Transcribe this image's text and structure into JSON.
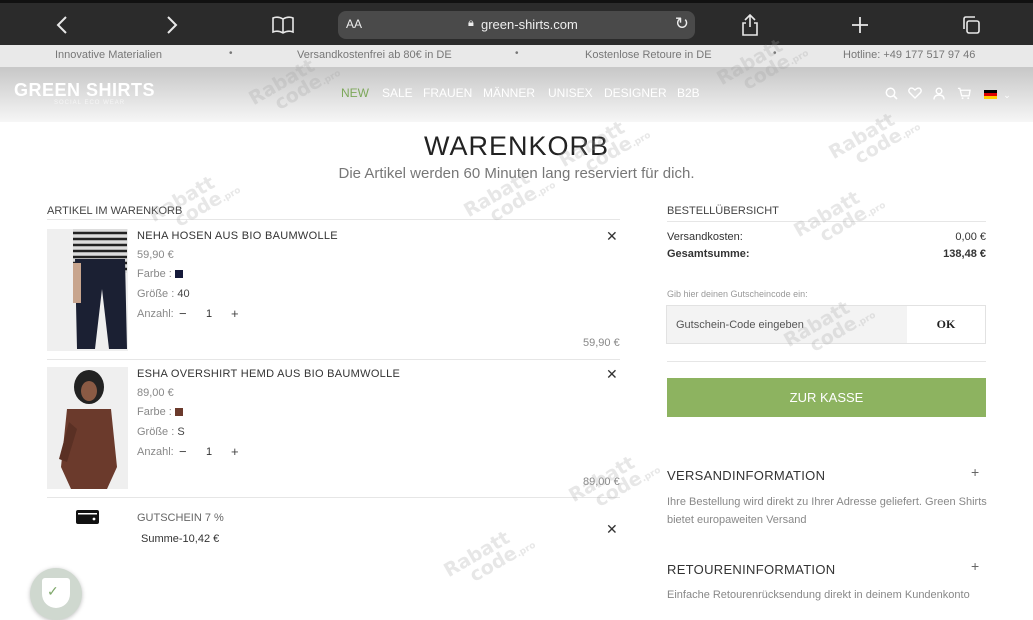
{
  "browser": {
    "aa_label": "AA",
    "url": "green-shirts.com"
  },
  "infobar": {
    "items": [
      "Innovative Materialien",
      "Versandkostenfrei ab 80€ in DE",
      "Kostenlose Retoure in DE",
      "Hotline: +49 177 517 97 46"
    ],
    "separator": "•"
  },
  "header": {
    "logo": "GREEN SHIRTS",
    "logo_tagline": "SOCIAL ECO WEAR",
    "nav": [
      "NEW",
      "SALE",
      "FRAUEN",
      "MÄNNER",
      "UNISEX",
      "DESIGNER",
      "B2B"
    ],
    "active_nav": "NEW",
    "active_color": "#7da85a"
  },
  "page": {
    "title": "WARENKORB",
    "subtitle": "Die Artikel werden 60 Minuten lang reserviert für dich."
  },
  "cart": {
    "heading": "ARTIKEL IM WARENKORB",
    "items": [
      {
        "name": "NEHA HOSEN AUS BIO BAUMWOLLE",
        "unit_price": "59,90 €",
        "color_label": "Farbe :",
        "color": "#151a3a",
        "size_label": "Größe :",
        "size": "40",
        "qty_label": "Anzahl:",
        "qty": "1",
        "total": "59,90 €"
      },
      {
        "name": "ESHA OVERSHIRT HEMD AUS BIO BAUMWOLLE",
        "unit_price": "89,00 €",
        "color_label": "Farbe :",
        "color": "#6b3a2c",
        "size_label": "Größe :",
        "size": "S",
        "qty_label": "Anzahl:",
        "qty": "1",
        "total": "89,00 €"
      }
    ],
    "voucher": {
      "name": "GUTSCHEIN 7 %",
      "sum": "Summe-10,42 €"
    },
    "qty_minus": "−",
    "qty_plus": "+",
    "remove": "✕"
  },
  "summary": {
    "heading": "BESTELLÜBERSICHT",
    "shipping_label": "Versandkosten:",
    "shipping_value": "0,00 €",
    "total_label": "Gesamtsumme:",
    "total_value": "138,48 €",
    "coupon_hint": "Gib hier deinen Gutscheincode ein:",
    "coupon_placeholder": "Gutschein-Code eingeben",
    "ok_label": "OK",
    "checkout_label": "ZUR KASSE",
    "checkout_color": "#8db360"
  },
  "accordion": [
    {
      "title": "VERSANDINFORMATION",
      "body_line1": "Ihre Bestellung wird direkt zu Ihrer Adresse geliefert. Green Shirts",
      "body_line2": "bietet europaweiten Versand"
    },
    {
      "title": "RETOURENINFORMATION",
      "body_line1": "Einfache Retourenrücksendung direkt in deinem Kundenkonto"
    }
  ],
  "accordion_plus": "+",
  "watermark": {
    "line1": "Rabatt",
    "line2": "code",
    "suffix": ".pro"
  }
}
